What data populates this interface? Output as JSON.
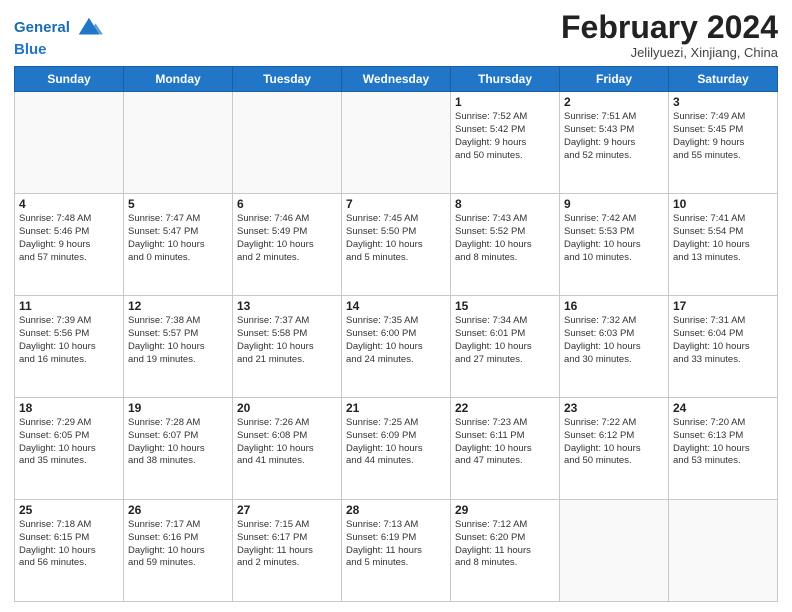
{
  "header": {
    "logo_line1": "General",
    "logo_line2": "Blue",
    "month_title": "February 2024",
    "subtitle": "Jelilyuezi, Xinjiang, China"
  },
  "weekdays": [
    "Sunday",
    "Monday",
    "Tuesday",
    "Wednesday",
    "Thursday",
    "Friday",
    "Saturday"
  ],
  "weeks": [
    [
      {
        "day": "",
        "info": ""
      },
      {
        "day": "",
        "info": ""
      },
      {
        "day": "",
        "info": ""
      },
      {
        "day": "",
        "info": ""
      },
      {
        "day": "1",
        "info": "Sunrise: 7:52 AM\nSunset: 5:42 PM\nDaylight: 9 hours\nand 50 minutes."
      },
      {
        "day": "2",
        "info": "Sunrise: 7:51 AM\nSunset: 5:43 PM\nDaylight: 9 hours\nand 52 minutes."
      },
      {
        "day": "3",
        "info": "Sunrise: 7:49 AM\nSunset: 5:45 PM\nDaylight: 9 hours\nand 55 minutes."
      }
    ],
    [
      {
        "day": "4",
        "info": "Sunrise: 7:48 AM\nSunset: 5:46 PM\nDaylight: 9 hours\nand 57 minutes."
      },
      {
        "day": "5",
        "info": "Sunrise: 7:47 AM\nSunset: 5:47 PM\nDaylight: 10 hours\nand 0 minutes."
      },
      {
        "day": "6",
        "info": "Sunrise: 7:46 AM\nSunset: 5:49 PM\nDaylight: 10 hours\nand 2 minutes."
      },
      {
        "day": "7",
        "info": "Sunrise: 7:45 AM\nSunset: 5:50 PM\nDaylight: 10 hours\nand 5 minutes."
      },
      {
        "day": "8",
        "info": "Sunrise: 7:43 AM\nSunset: 5:52 PM\nDaylight: 10 hours\nand 8 minutes."
      },
      {
        "day": "9",
        "info": "Sunrise: 7:42 AM\nSunset: 5:53 PM\nDaylight: 10 hours\nand 10 minutes."
      },
      {
        "day": "10",
        "info": "Sunrise: 7:41 AM\nSunset: 5:54 PM\nDaylight: 10 hours\nand 13 minutes."
      }
    ],
    [
      {
        "day": "11",
        "info": "Sunrise: 7:39 AM\nSunset: 5:56 PM\nDaylight: 10 hours\nand 16 minutes."
      },
      {
        "day": "12",
        "info": "Sunrise: 7:38 AM\nSunset: 5:57 PM\nDaylight: 10 hours\nand 19 minutes."
      },
      {
        "day": "13",
        "info": "Sunrise: 7:37 AM\nSunset: 5:58 PM\nDaylight: 10 hours\nand 21 minutes."
      },
      {
        "day": "14",
        "info": "Sunrise: 7:35 AM\nSunset: 6:00 PM\nDaylight: 10 hours\nand 24 minutes."
      },
      {
        "day": "15",
        "info": "Sunrise: 7:34 AM\nSunset: 6:01 PM\nDaylight: 10 hours\nand 27 minutes."
      },
      {
        "day": "16",
        "info": "Sunrise: 7:32 AM\nSunset: 6:03 PM\nDaylight: 10 hours\nand 30 minutes."
      },
      {
        "day": "17",
        "info": "Sunrise: 7:31 AM\nSunset: 6:04 PM\nDaylight: 10 hours\nand 33 minutes."
      }
    ],
    [
      {
        "day": "18",
        "info": "Sunrise: 7:29 AM\nSunset: 6:05 PM\nDaylight: 10 hours\nand 35 minutes."
      },
      {
        "day": "19",
        "info": "Sunrise: 7:28 AM\nSunset: 6:07 PM\nDaylight: 10 hours\nand 38 minutes."
      },
      {
        "day": "20",
        "info": "Sunrise: 7:26 AM\nSunset: 6:08 PM\nDaylight: 10 hours\nand 41 minutes."
      },
      {
        "day": "21",
        "info": "Sunrise: 7:25 AM\nSunset: 6:09 PM\nDaylight: 10 hours\nand 44 minutes."
      },
      {
        "day": "22",
        "info": "Sunrise: 7:23 AM\nSunset: 6:11 PM\nDaylight: 10 hours\nand 47 minutes."
      },
      {
        "day": "23",
        "info": "Sunrise: 7:22 AM\nSunset: 6:12 PM\nDaylight: 10 hours\nand 50 minutes."
      },
      {
        "day": "24",
        "info": "Sunrise: 7:20 AM\nSunset: 6:13 PM\nDaylight: 10 hours\nand 53 minutes."
      }
    ],
    [
      {
        "day": "25",
        "info": "Sunrise: 7:18 AM\nSunset: 6:15 PM\nDaylight: 10 hours\nand 56 minutes."
      },
      {
        "day": "26",
        "info": "Sunrise: 7:17 AM\nSunset: 6:16 PM\nDaylight: 10 hours\nand 59 minutes."
      },
      {
        "day": "27",
        "info": "Sunrise: 7:15 AM\nSunset: 6:17 PM\nDaylight: 11 hours\nand 2 minutes."
      },
      {
        "day": "28",
        "info": "Sunrise: 7:13 AM\nSunset: 6:19 PM\nDaylight: 11 hours\nand 5 minutes."
      },
      {
        "day": "29",
        "info": "Sunrise: 7:12 AM\nSunset: 6:20 PM\nDaylight: 11 hours\nand 8 minutes."
      },
      {
        "day": "",
        "info": ""
      },
      {
        "day": "",
        "info": ""
      }
    ]
  ]
}
